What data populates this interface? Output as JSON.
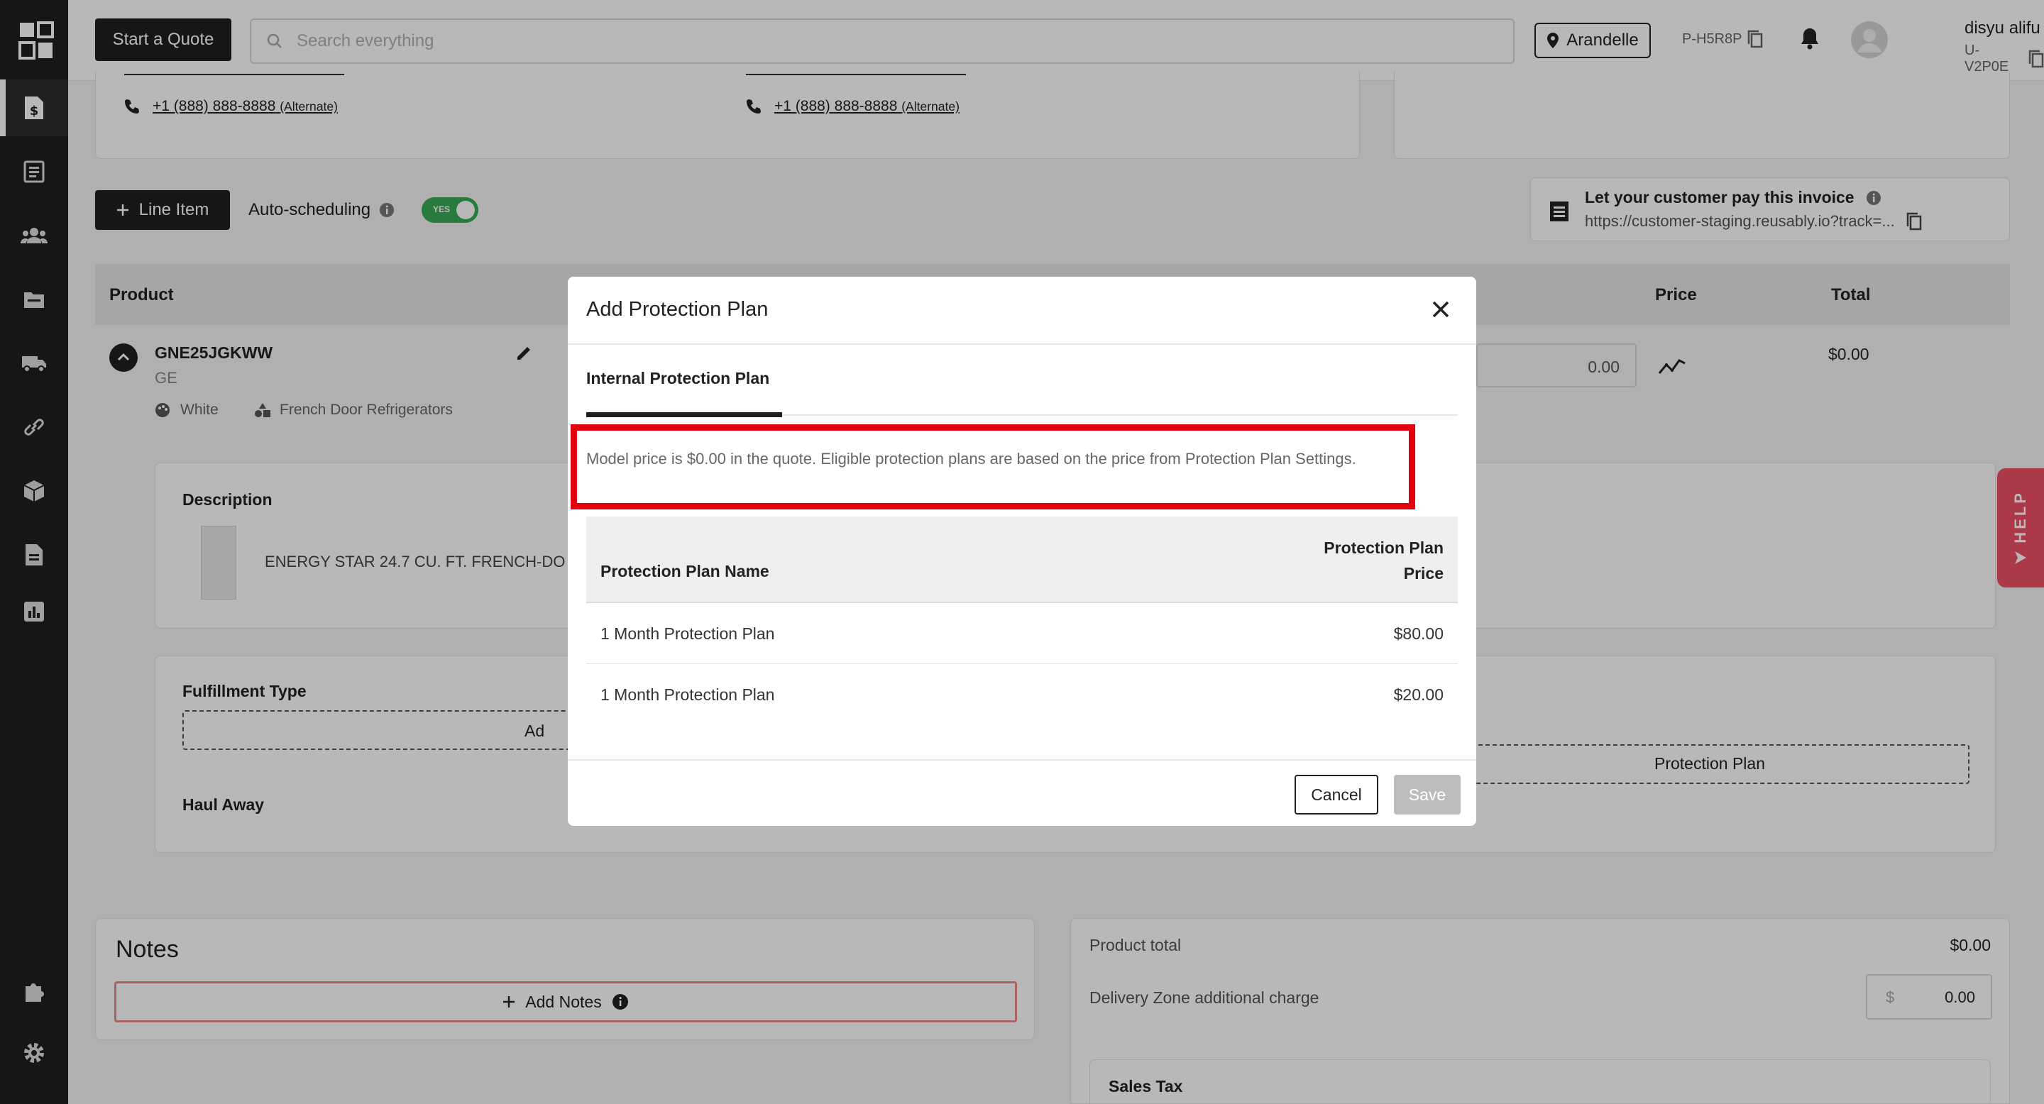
{
  "topbar": {
    "start_quote": "Start a Quote",
    "search_placeholder": "Search everything",
    "location": "Arandelle",
    "profile_id": "P-H5R8P",
    "user_name": "disyu alifu",
    "user_id": "U-V2P0E"
  },
  "contacts": {
    "left_phone": "+1 (888) 888-8888",
    "left_phone_tag": "(Alternate)",
    "right_phone": "+1 (888) 888-8888",
    "right_phone_tag": "(Alternate)"
  },
  "toolbar": {
    "line_item": "Line Item",
    "auto_scheduling": "Auto-scheduling",
    "toggle_label": "YES"
  },
  "pay_card": {
    "title": "Let your customer pay this invoice",
    "link": "https://customer-staging.reusably.io?track=..."
  },
  "table": {
    "col_product": "Product",
    "col_price": "Price",
    "col_total": "Total"
  },
  "product": {
    "sku": "GNE25JGKWW",
    "brand": "GE",
    "color": "White",
    "category": "French Door Refrigerators",
    "price_input": "0.00",
    "total": "$0.00",
    "description_label": "Description",
    "description_text": "ENERGY STAR 24.7 CU. FT. FRENCH-DO",
    "fulfillment_label": "Fulfillment Type",
    "fulfillment_button": "Ad",
    "haul_away_label": "Haul Away",
    "protection_plan_field": "Protection Plan"
  },
  "notes": {
    "title": "Notes",
    "add_notes": "Add Notes"
  },
  "summary": {
    "product_total_label": "Product total",
    "product_total_value": "$0.00",
    "delivery_zone_label": "Delivery Zone additional charge",
    "delivery_zone_currency": "$",
    "delivery_zone_value": "0.00",
    "sales_tax_label": "Sales Tax"
  },
  "help": {
    "label": "HELP"
  },
  "modal": {
    "title": "Add Protection Plan",
    "tab": "Internal Protection Plan",
    "notice": "Model price is $0.00 in the quote. Eligible protection plans are based on the price from Protection Plan Settings.",
    "col_name": "Protection Plan Name",
    "col_price_line1": "Protection Plan",
    "col_price_line2": "Price",
    "rows": [
      {
        "name": "1 Month Protection Plan",
        "price": "$80.00"
      },
      {
        "name": "1 Month Protection Plan",
        "price": "$20.00"
      }
    ],
    "cancel": "Cancel",
    "save": "Save"
  },
  "colors": {
    "sidebar": "#1f1f1f",
    "highlight": "#e3000f",
    "toggle_on": "#3aaa55",
    "help": "#ee4f63"
  }
}
